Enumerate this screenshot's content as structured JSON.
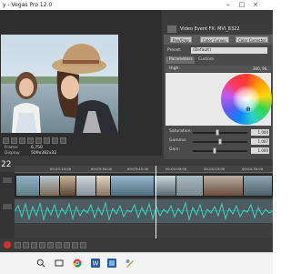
{
  "window": {
    "title": "y - Vegas Pro 12.0"
  },
  "preview": {
    "frame_label": "Frame:",
    "frame_value": "6,750",
    "display_label": "Display:",
    "display_value": "509x382x32"
  },
  "fx_panel": {
    "title": "Video Event FX: MVI_8322",
    "chain": [
      "Pan/Crop",
      "Color Curves",
      "Color Corrector"
    ],
    "preset_label": "Preset:",
    "preset_value": "(Default)",
    "tabs": [
      "Parameters",
      "Custom"
    ],
    "high_label": "High:",
    "high_value": "300, 96, ",
    "sliders": [
      {
        "label": "Saturation:",
        "value": "1.000",
        "level": 0.45
      },
      {
        "label": "Gamma:",
        "value": "1.007",
        "level": 0.5
      },
      {
        "label": "Gain:",
        "value": "1.000",
        "level": 0.4
      }
    ]
  },
  "timeline": {
    "timecode": "22",
    "ruler_ticks": [
      "00:03:15:00",
      "00:03:30:00",
      "00:03:45:00",
      "00:04:00:00",
      "00:04:15:00",
      "00:04:30:00"
    ]
  },
  "colors": {
    "workspace": "#3a3a3a",
    "panel": "#4a4a4a",
    "audio_waveform": "#3fd2c0",
    "playhead": "#f5f5f5"
  }
}
